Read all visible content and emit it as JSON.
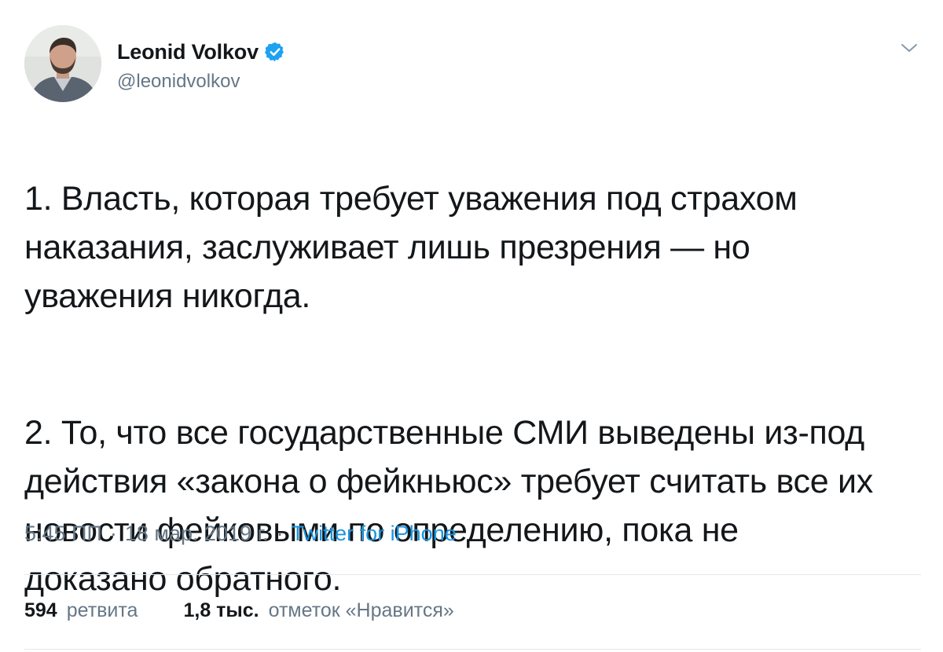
{
  "author": {
    "name": "Leonid Volkov",
    "handle": "@leonidvolkov",
    "verified": true,
    "avatar_icon": "user-photo",
    "verified_icon": "verified-badge-icon"
  },
  "menu_icon": "chevron-down-icon",
  "tweet": {
    "paragraphs": [
      "1. Власть, которая требует уважения под страхом\nнаказания, заслуживает лишь презрения — но\nуважения никогда.",
      "2. То, что все государственные СМИ выведены из-под\nдействия «закона о фейкньюс» требует считать все их\nновости фейковыми по определению, пока не\nдоказано обратного."
    ]
  },
  "meta": {
    "time": "5:45 ПП",
    "separator": "·",
    "date": "18 мар. 2019 г.",
    "source": "Twitter for iPhone"
  },
  "stats": {
    "retweets_count": "594",
    "retweets_label": "ретвита",
    "likes_count": "1,8 тыс.",
    "likes_label": "отметок «Нравится»"
  },
  "colors": {
    "text": "#14171a",
    "secondary": "#657786",
    "link": "#1b95e0",
    "verified": "#1da1f2",
    "divider": "#e1e8ed"
  }
}
